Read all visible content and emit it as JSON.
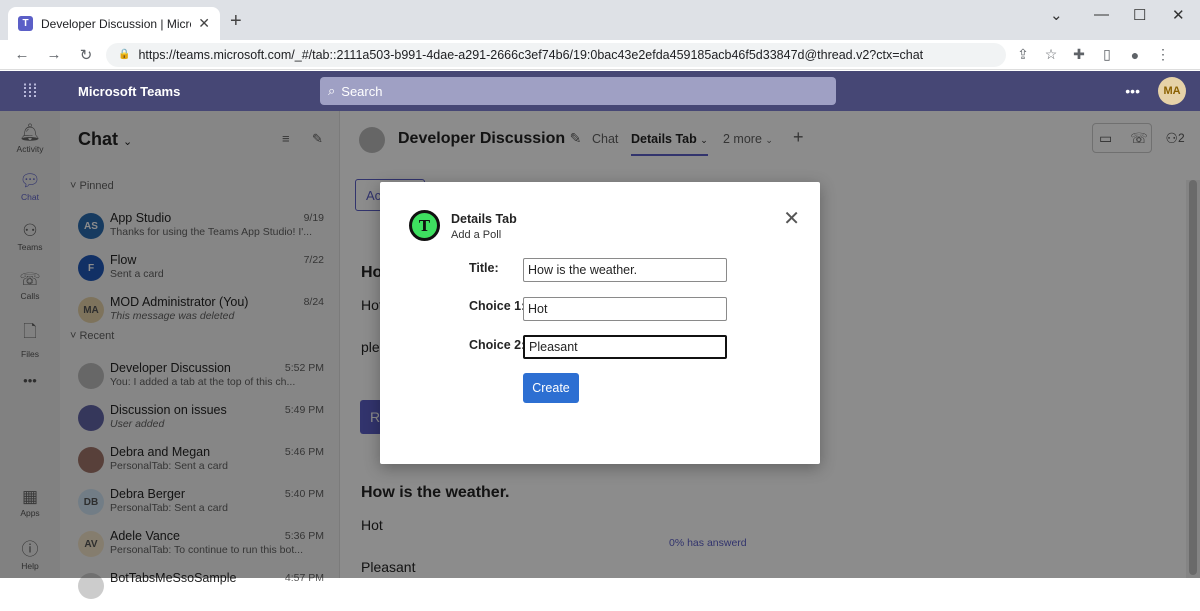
{
  "browser": {
    "tab_title": "Developer Discussion | Microsoft Teams",
    "url": "https://teams.microsoft.com/_#/tab::2111a503-b991-4dae-a291-2666c3ef74b6/19:0bac43e2efda459185acb46f5d33847d@thread.v2?ctx=chat",
    "minimize_icon": "chevron-down-icon"
  },
  "teams": {
    "app_name": "Microsoft Teams",
    "search_placeholder": "Search",
    "user_initials": "MA"
  },
  "rail": {
    "items": [
      {
        "label": "Activity",
        "icon": "bell-icon"
      },
      {
        "label": "Chat",
        "icon": "chat-icon"
      },
      {
        "label": "Teams",
        "icon": "teams-icon"
      },
      {
        "label": "Calls",
        "icon": "phone-icon"
      },
      {
        "label": "Files",
        "icon": "file-icon"
      },
      {
        "label": "Apps",
        "icon": "apps-icon"
      },
      {
        "label": "Help",
        "icon": "help-icon"
      }
    ],
    "more": "•••"
  },
  "chat_list": {
    "title": "Chat",
    "pinned_label": "Pinned",
    "recent_label": "Recent",
    "pinned": [
      {
        "name": "App Studio",
        "time": "9/19",
        "preview": "Thanks for using the Teams App Studio! I'...",
        "italic": false,
        "av_text": "AS",
        "av_color": "#2b6cb0"
      },
      {
        "name": "Flow",
        "time": "7/22",
        "preview": "Sent a card",
        "italic": false,
        "av_text": "F",
        "av_color": "#2058b8"
      },
      {
        "name": "MOD Administrator (You)",
        "time": "8/24",
        "preview": "This message was deleted",
        "italic": true,
        "av_text": "MA",
        "av_color": "#e6d2a8"
      }
    ],
    "recent": [
      {
        "name": "Developer Discussion",
        "time": "5:52 PM",
        "preview": "You: I added a tab at the top of this ch...",
        "italic": false,
        "av_text": "",
        "av_color": "#bcbcbc"
      },
      {
        "name": "Discussion on issues",
        "time": "5:49 PM",
        "preview": "User added",
        "italic": true,
        "av_text": "",
        "av_color": "#6264a7"
      },
      {
        "name": "Debra and Megan",
        "time": "5:46 PM",
        "preview": "PersonalTab: Sent a card",
        "italic": false,
        "av_text": "",
        "av_color": "#a0766a"
      },
      {
        "name": "Debra Berger",
        "time": "5:40 PM",
        "preview": "PersonalTab: Sent a card",
        "italic": false,
        "av_text": "DB",
        "av_color": "#cfe4f5"
      },
      {
        "name": "Adele Vance",
        "time": "5:36 PM",
        "preview": "PersonalTab: To continue to run this bot...",
        "italic": false,
        "av_text": "AV",
        "av_color": "#f3e4c8"
      },
      {
        "name": "BotTabsMeSsoSample",
        "time": "4:57 PM",
        "preview": "",
        "italic": false,
        "av_text": "",
        "av_color": "#cccccc"
      }
    ]
  },
  "main": {
    "chat_title": "Developer Discussion",
    "tabs": [
      "Chat",
      "Details Tab",
      "2 more"
    ],
    "participants": "2",
    "poll_question": "How is the weather.",
    "answers": [
      "Hot",
      "Pleasant"
    ],
    "answered": "0% has answerd",
    "bg_question_partial": "Ho",
    "bg_line1_partial": "Hot",
    "bg_line2_partial": "ple",
    "bg_btn_partial": "Ac",
    "bg_btn2_partial": "R"
  },
  "dialog": {
    "app_letter": "T",
    "title": "Details Tab",
    "subtitle": "Add a Poll",
    "title_label": "Title:",
    "title_value": "How is the weather.",
    "choice1_label": "Choice 1:",
    "choice1_value": "Hot",
    "choice2_label": "Choice 2:",
    "choice2_value": "Pleasant",
    "create_label": "Create",
    "close_glyph": "✕"
  }
}
